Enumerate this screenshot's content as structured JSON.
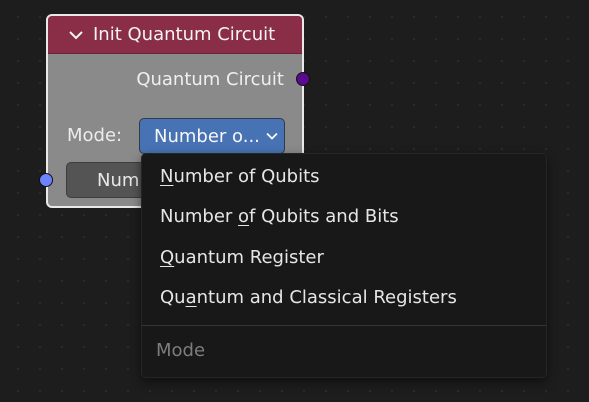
{
  "node": {
    "title": "Init Quantum Circuit",
    "output_label": "Quantum Circuit",
    "mode_label": "Mode:",
    "mode_value": "Number o...",
    "num_field_text": "Num",
    "header_color": "#8a2d47",
    "output_socket_color": "#5a0a8e",
    "input_socket_color": "#6b83ff"
  },
  "dropdown": {
    "items": [
      {
        "pre": "",
        "u": "N",
        "post": "umber of Qubits"
      },
      {
        "pre": "Number ",
        "u": "o",
        "post": "f Qubits and Bits"
      },
      {
        "pre": "",
        "u": "Q",
        "post": "uantum Register"
      },
      {
        "pre": "Qu",
        "u": "a",
        "post": "ntum and Classical Registers"
      }
    ],
    "title": "Mode"
  }
}
